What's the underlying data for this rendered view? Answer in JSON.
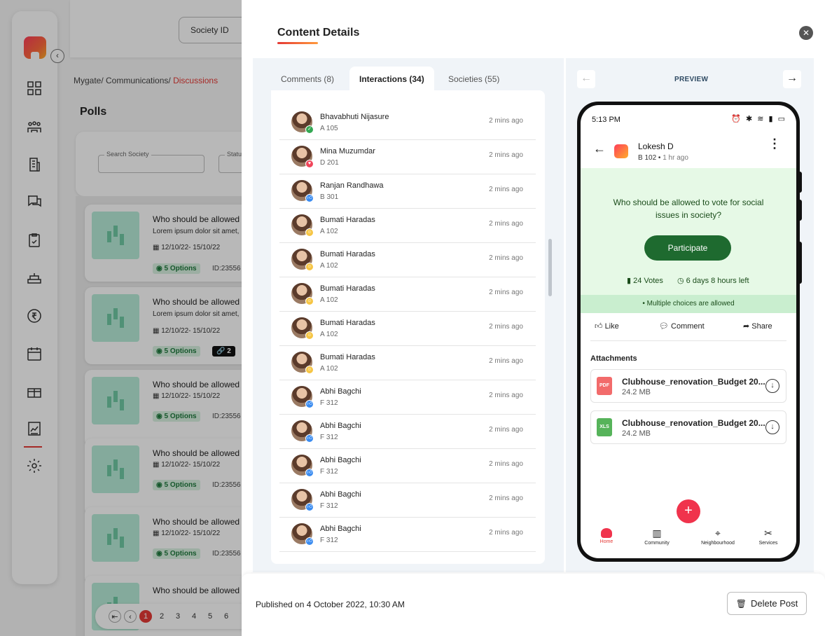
{
  "background": {
    "society_id_label": "Society ID",
    "breadcrumb": {
      "path": "Mygate/ Communications/ ",
      "current": "Discussions"
    },
    "page_title": "Polls",
    "filters": {
      "search_society": "Search Society",
      "status": "Statu"
    },
    "polls": [
      {
        "question": "Who should be allowed",
        "desc": "Lorem ipsum dolor sit amet,",
        "dates": "12/10/22- 15/10/22",
        "options": "◉ 5 Options",
        "id": "ID:23556"
      },
      {
        "question": "Who should be allowed",
        "desc": "Lorem ipsum dolor sit amet,",
        "dates": "12/10/22- 15/10/22",
        "options": "◉ 5 Options",
        "id": "2"
      },
      {
        "question": "Who should be allowed",
        "desc": "",
        "dates": "12/10/22- 15/10/22",
        "options": "◉ 5 Options",
        "id": "ID:23556"
      },
      {
        "question": "Who should be allowed",
        "desc": "",
        "dates": "12/10/22- 15/10/22",
        "options": "◉ 5 Options",
        "id": "ID:23556"
      },
      {
        "question": "Who should be allowed",
        "desc": "",
        "dates": "12/10/22- 15/10/22",
        "options": "◉ 5 Options",
        "id": "ID:23556"
      },
      {
        "question": "Who should be allowed",
        "desc": "",
        "dates": "",
        "options": "",
        "id": ""
      }
    ],
    "pagination": [
      "1",
      "2",
      "3",
      "4",
      "5",
      "6"
    ]
  },
  "drawer": {
    "title": "Content Details",
    "tabs": [
      "Comments (8)",
      "Interactions (34)",
      "Societies (55)"
    ],
    "interactions": [
      {
        "name": "Bhavabhuti Nijasure",
        "unit": "A 105",
        "time": "2 mins ago",
        "reaction": "green"
      },
      {
        "name": "Mina Muzumdar",
        "unit": "D 201",
        "time": "2 mins ago",
        "reaction": "love"
      },
      {
        "name": "Ranjan Randhawa",
        "unit": "B 301",
        "time": "2 mins ago",
        "reaction": "like"
      },
      {
        "name": "Bumati Haradas",
        "unit": "A 102",
        "time": "2 mins ago",
        "reaction": "laugh"
      },
      {
        "name": "Bumati Haradas",
        "unit": "A 102",
        "time": "2 mins ago",
        "reaction": "laugh"
      },
      {
        "name": "Bumati Haradas",
        "unit": "A 102",
        "time": "2 mins ago",
        "reaction": "laugh"
      },
      {
        "name": "Bumati Haradas",
        "unit": "A 102",
        "time": "2 mins ago",
        "reaction": "laugh"
      },
      {
        "name": "Bumati Haradas",
        "unit": "A 102",
        "time": "2 mins ago",
        "reaction": "laugh"
      },
      {
        "name": "Abhi Bagchi",
        "unit": "F 312",
        "time": "2 mins ago",
        "reaction": "like"
      },
      {
        "name": "Abhi Bagchi",
        "unit": "F 312",
        "time": "2 mins ago",
        "reaction": "like"
      },
      {
        "name": "Abhi Bagchi",
        "unit": "F 312",
        "time": "2 mins ago",
        "reaction": "like"
      },
      {
        "name": "Abhi Bagchi",
        "unit": "F 312",
        "time": "2 mins ago",
        "reaction": "like"
      },
      {
        "name": "Abhi Bagchi",
        "unit": "F 312",
        "time": "2 mins ago",
        "reaction": "like"
      }
    ],
    "preview": {
      "label": "PREVIEW",
      "status_time": "5:13 PM",
      "author": "Lokesh D",
      "unit": "B 102",
      "ago": "1 hr ago",
      "question": "Who should be allowed to vote for social issues in society?",
      "participate": "Participate",
      "votes": "24 Votes",
      "time_left": "6 days 8 hours left",
      "multi": "• Multiple choices are allowed",
      "actions": {
        "like": "Like",
        "comment": "Comment",
        "share": "Share"
      },
      "attachments_title": "Attachments",
      "files": [
        {
          "type": "PDF",
          "name": "Clubhouse_renovation_Budget 20...",
          "size": "24.2 MB"
        },
        {
          "type": "XLS",
          "name": "Clubhouse_renovation_Budget 20...",
          "size": "24.2 MB"
        }
      ],
      "bottom_nav": [
        "Home",
        "Community",
        "Neighbourhood",
        "Services"
      ]
    },
    "footer": {
      "published": "Published on 4 October 2022, 10:30 AM",
      "delete_label": "Delete Post"
    }
  }
}
